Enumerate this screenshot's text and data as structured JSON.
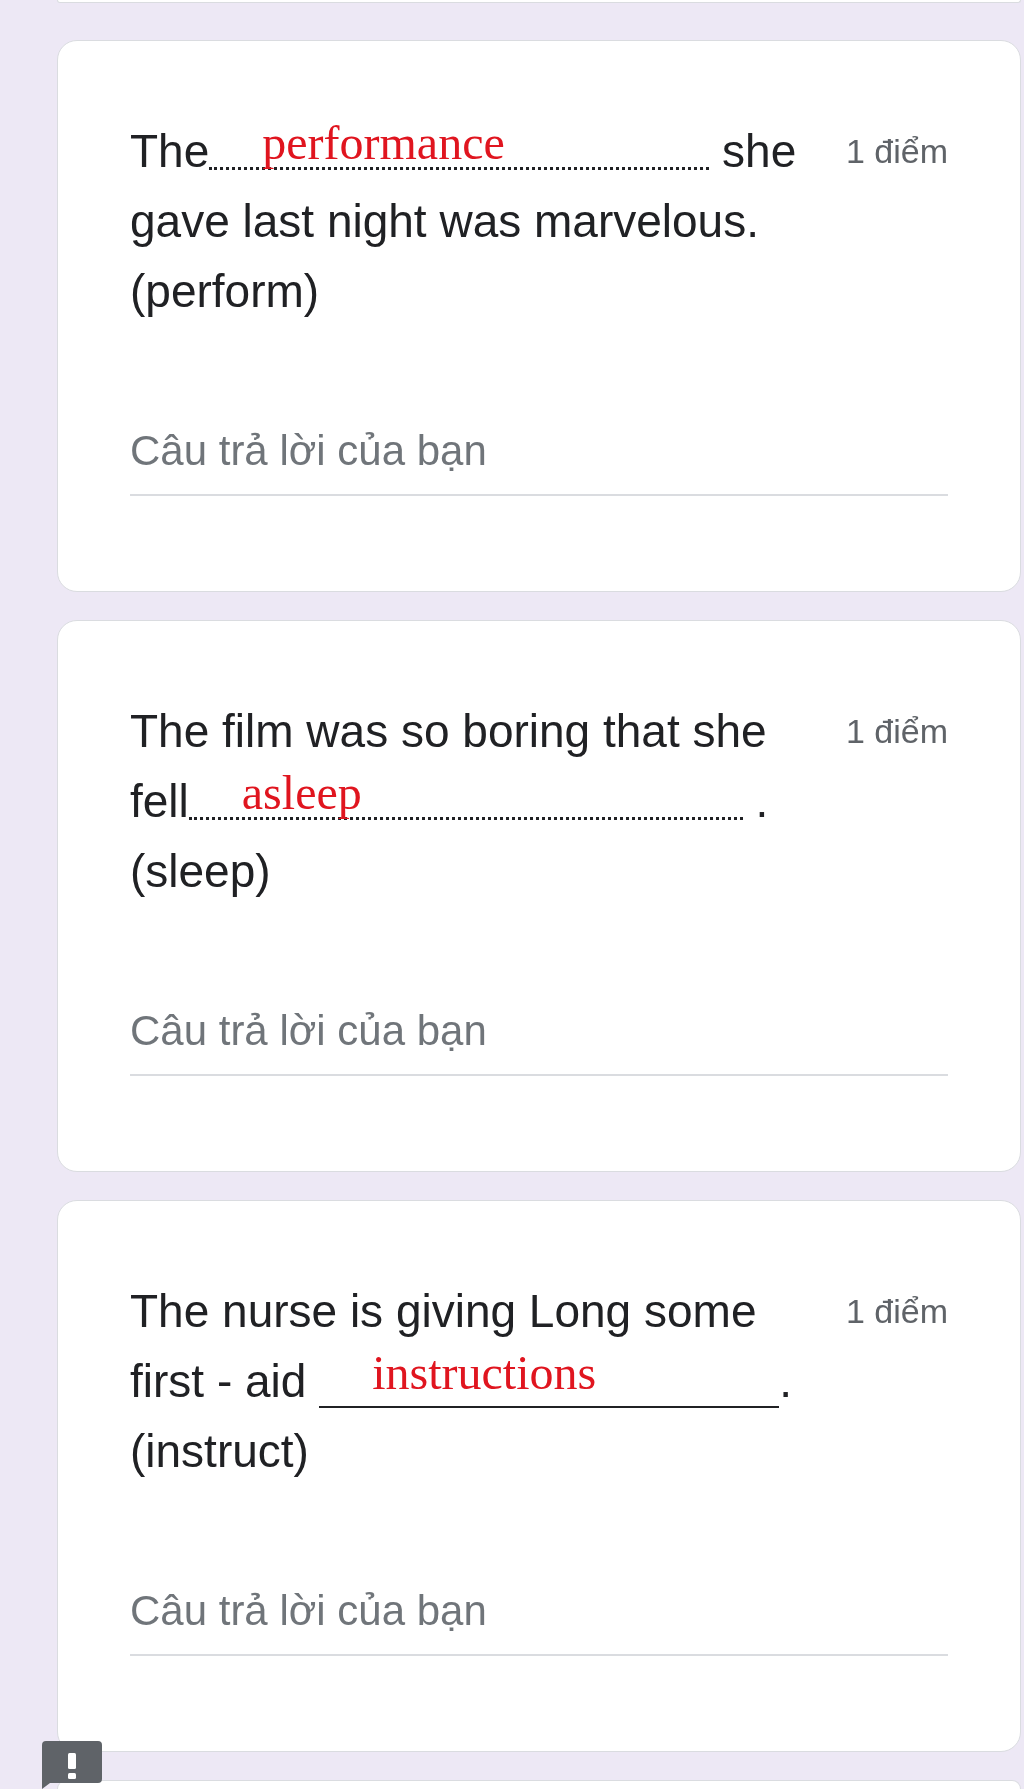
{
  "questions": [
    {
      "text_before": "The",
      "blank": {
        "kind": "dotted",
        "value": "performance"
      },
      "text_after": " she gave last night was marvelous. (perform)",
      "points": "1 điểm",
      "answer_field": {
        "placeholder": "Câu trả lời của bạn"
      }
    },
    {
      "text_before": "The film was so boring that she fell",
      "blank": {
        "kind": "dotted",
        "value": "asleep"
      },
      "text_after": " . (sleep)",
      "points": "1 điểm",
      "answer_field": {
        "placeholder": "Câu trả lời của bạn"
      }
    },
    {
      "text_before": "The nurse is giving Long some first - aid ",
      "blank": {
        "kind": "solid",
        "value": "instructions"
      },
      "text_after": ". (instruct)",
      "points": "1 điểm",
      "answer_field": {
        "placeholder": "Câu trả lời của bạn"
      }
    }
  ]
}
